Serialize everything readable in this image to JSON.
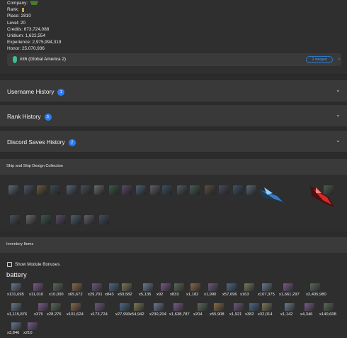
{
  "profile": {
    "company_label": "Company:",
    "rank_label": "Rank:",
    "place": "Place: 2810",
    "level": "Level: 20",
    "credits": "Credits: 673,724,088",
    "uridium": "Uridium: 1,622,554",
    "experience": "Experience: 2,975,994,319",
    "honor": "Honor: 25,070,936",
    "server": "int6 (Global America 2)",
    "merged_badge": "2 merged",
    "colors": {
      "accent": "#2d7ef0",
      "gem": "#3fbf8a"
    }
  },
  "accordions": [
    {
      "title": "Username History",
      "count": "1"
    },
    {
      "title": "Rank History",
      "count": "5"
    },
    {
      "title": "Discord Saves History",
      "count": "2"
    }
  ],
  "ships_panel": {
    "title": "Ship and Ship Design Collection"
  },
  "inventory": {
    "title": "Inventory Items",
    "show_bonuses_label": "Show Module Bonuses",
    "category": "battery",
    "row1": [
      "x131,695",
      "x11,010",
      "x10,000",
      "x65,672",
      "x29,701",
      "x843",
      "x69,582",
      "x5,135",
      "x92",
      "x833",
      "x1,182",
      "x1,990",
      "x57,696",
      "x163",
      "x107,375",
      "x1,661,297",
      "x2,405,980"
    ],
    "row2": [
      "x1,115,876",
      "x375",
      "x28,276",
      "x101,624",
      "x173,724",
      "x27,990",
      "x54,942",
      "x230,204",
      "x1,638,787",
      "x204",
      "x55,908",
      "x1,921",
      "x382",
      "x32,014",
      "x1,142",
      "x4,346",
      "x140,608"
    ],
    "row3": [
      "x3,846",
      "x210"
    ]
  }
}
